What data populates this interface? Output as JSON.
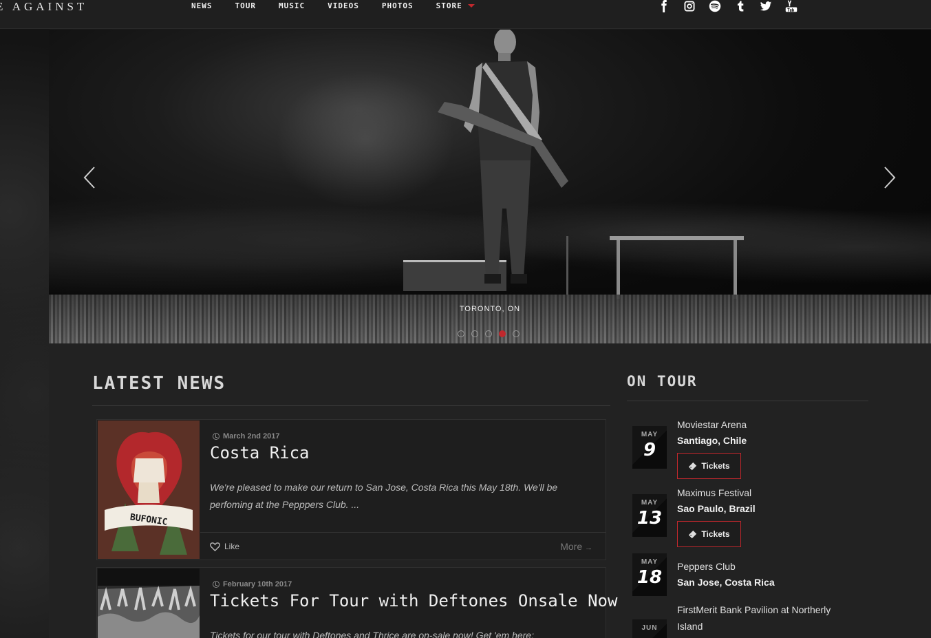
{
  "header": {
    "logo_text": "E AGAINST",
    "nav": [
      {
        "label": "NEWS"
      },
      {
        "label": "TOUR"
      },
      {
        "label": "MUSIC"
      },
      {
        "label": "VIDEOS"
      },
      {
        "label": "PHOTOS"
      },
      {
        "label": "STORE"
      }
    ],
    "social_icons": [
      "facebook-icon",
      "instagram-icon",
      "spotify-icon",
      "tumblr-icon",
      "twitter-icon",
      "youtube-icon"
    ]
  },
  "hero": {
    "caption": "TORONTO, ON",
    "slide_count": 5,
    "active_slide": 4
  },
  "news": {
    "title": "LATEST NEWS",
    "items": [
      {
        "date": "March 2nd 2017",
        "title": "Costa Rica",
        "excerpt": "We're pleased to make our return to San Jose, Costa Rica this May 18th.  We'll be perfoming at the Pepppers Club.  ...",
        "like_label": "Like",
        "more_label": "More",
        "thumb_text": "BUFONIC"
      },
      {
        "date": "February 10th 2017",
        "title": "Tickets For Tour with Deftones Onsale Now",
        "excerpt": "Tickets for our tour with Deftones and Thrice are on-sale now! Get 'em here:"
      }
    ]
  },
  "tour": {
    "title": "ON TOUR",
    "ticket_label": "Tickets",
    "items": [
      {
        "month": "MAY",
        "day": "9",
        "venue": "Moviestar Arena",
        "city": "Santiago, Chile",
        "has_tickets": true
      },
      {
        "month": "MAY",
        "day": "13",
        "venue": "Maximus Festival",
        "city": "Sao Paulo, Brazil",
        "has_tickets": true
      },
      {
        "month": "MAY",
        "day": "18",
        "venue": "Peppers Club",
        "city": "San Jose, Costa Rica",
        "has_tickets": false
      },
      {
        "month": "JUN",
        "day": "",
        "venue": "FirstMerit Bank Pavilion at Northerly Island",
        "city": "",
        "has_tickets": false
      }
    ]
  },
  "colors": {
    "accent": "#c0282d",
    "background": "#222222",
    "header": "#1f1f1f"
  }
}
